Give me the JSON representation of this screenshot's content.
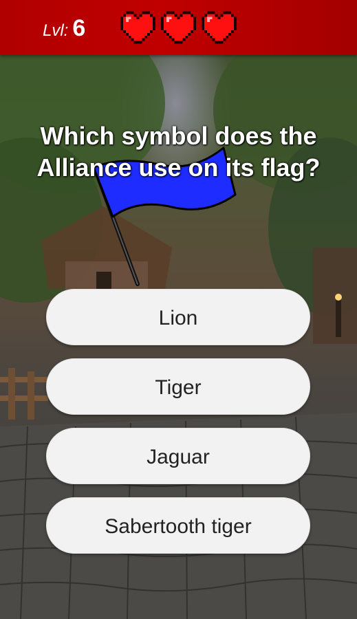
{
  "header": {
    "level_label": "Lvl:",
    "level_value": "6",
    "lives": 3,
    "heart_color": "#ff0000",
    "bar_color": "#c00000"
  },
  "question": {
    "text": "Which symbol does the Alliance use on its flag?",
    "image_icon": "blue-flag-icon",
    "flag_color": "#1f2cff"
  },
  "answers": [
    {
      "label": "Lion"
    },
    {
      "label": "Tiger"
    },
    {
      "label": "Jaguar"
    },
    {
      "label": "Sabertooth tiger"
    }
  ]
}
